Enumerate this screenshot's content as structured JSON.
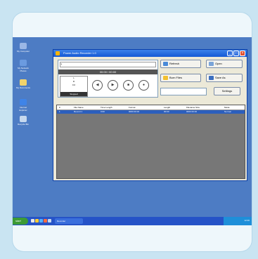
{
  "desktop": {
    "icons": [
      {
        "label": "My Computer",
        "color": "#9ab7e6"
      },
      {
        "label": "My Network Places",
        "color": "#6b9be0"
      },
      {
        "label": "My Documents",
        "color": "#f2d36b"
      },
      {
        "label": "Internet Explorer",
        "color": "#3f84e8"
      },
      {
        "label": "Recycle Bin",
        "color": "#c6d8ee"
      }
    ]
  },
  "window": {
    "title": "Power Audio Recorder 1.0",
    "track_field": "?",
    "time_display": "00:00 / 00:00",
    "lcd_rows": [
      "L",
      "R",
      "0.0"
    ],
    "lcd_footer": "Stopped",
    "knob_symbols": [
      "◀",
      "▶",
      "■",
      "●"
    ],
    "buttons": {
      "refresh": "Refresh",
      "open": "Open",
      "burn": "Burn Files",
      "save": "Save As",
      "settings": "Settings"
    },
    "tabs": [
      "Recorded",
      "Tracks"
    ],
    "table": {
      "columns": [
        "#",
        "File Name",
        "Time Length",
        "Format",
        "Length",
        "Filename Size",
        "Mode"
      ],
      "rows": [
        [
          "1",
          "Record 1",
          "0:00",
          "0000 00 00",
          "00:00",
          "0000 00 00",
          "Normal"
        ]
      ]
    }
  },
  "taskbar": {
    "start_label": "start",
    "task_label": "Recorder",
    "clock": "12:00",
    "quicklaunch_colors": [
      "#e8e8e8",
      "#ffcc33",
      "#4fb1ff",
      "#ff6a3d",
      "#c6d8ee"
    ]
  }
}
